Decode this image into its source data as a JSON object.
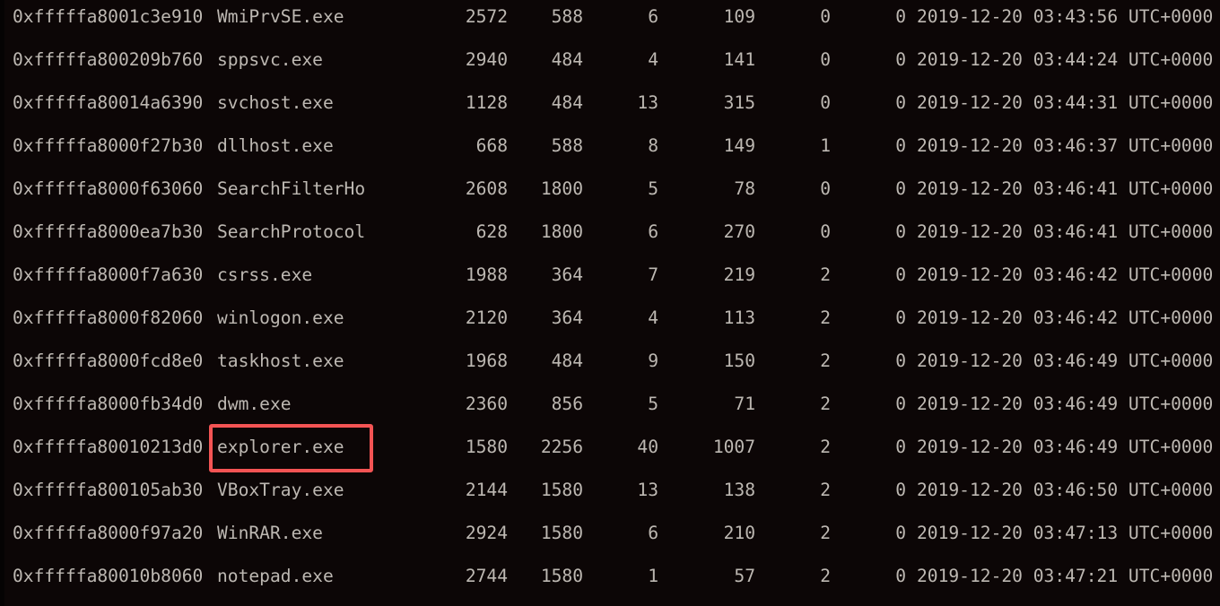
{
  "terminal": {
    "highlight_color": "#f45454",
    "highlighted_process": "explorer.exe",
    "rows": [
      {
        "offset": "0xfffffa8001c3e910",
        "name": "WmiPrvSE.exe",
        "pid": "2572",
        "ppid": "588",
        "threads": "6",
        "handles": "109",
        "session": "0",
        "wow64": "0",
        "start": "2019-12-20 03:43:56 UTC+0000"
      },
      {
        "offset": "0xfffffa800209b760",
        "name": "sppsvc.exe",
        "pid": "2940",
        "ppid": "484",
        "threads": "4",
        "handles": "141",
        "session": "0",
        "wow64": "0",
        "start": "2019-12-20 03:44:24 UTC+0000"
      },
      {
        "offset": "0xfffffa80014a6390",
        "name": "svchost.exe",
        "pid": "1128",
        "ppid": "484",
        "threads": "13",
        "handles": "315",
        "session": "0",
        "wow64": "0",
        "start": "2019-12-20 03:44:31 UTC+0000"
      },
      {
        "offset": "0xfffffa8000f27b30",
        "name": "dllhost.exe",
        "pid": "668",
        "ppid": "588",
        "threads": "8",
        "handles": "149",
        "session": "1",
        "wow64": "0",
        "start": "2019-12-20 03:46:37 UTC+0000"
      },
      {
        "offset": "0xfffffa8000f63060",
        "name": "SearchFilterHo",
        "pid": "2608",
        "ppid": "1800",
        "threads": "5",
        "handles": "78",
        "session": "0",
        "wow64": "0",
        "start": "2019-12-20 03:46:41 UTC+0000"
      },
      {
        "offset": "0xfffffa8000ea7b30",
        "name": "SearchProtocol",
        "pid": "628",
        "ppid": "1800",
        "threads": "6",
        "handles": "270",
        "session": "0",
        "wow64": "0",
        "start": "2019-12-20 03:46:41 UTC+0000"
      },
      {
        "offset": "0xfffffa8000f7a630",
        "name": "csrss.exe",
        "pid": "1988",
        "ppid": "364",
        "threads": "7",
        "handles": "219",
        "session": "2",
        "wow64": "0",
        "start": "2019-12-20 03:46:42 UTC+0000"
      },
      {
        "offset": "0xfffffa8000f82060",
        "name": "winlogon.exe",
        "pid": "2120",
        "ppid": "364",
        "threads": "4",
        "handles": "113",
        "session": "2",
        "wow64": "0",
        "start": "2019-12-20 03:46:42 UTC+0000"
      },
      {
        "offset": "0xfffffa8000fcd8e0",
        "name": "taskhost.exe",
        "pid": "1968",
        "ppid": "484",
        "threads": "9",
        "handles": "150",
        "session": "2",
        "wow64": "0",
        "start": "2019-12-20 03:46:49 UTC+0000"
      },
      {
        "offset": "0xfffffa8000fb34d0",
        "name": "dwm.exe",
        "pid": "2360",
        "ppid": "856",
        "threads": "5",
        "handles": "71",
        "session": "2",
        "wow64": "0",
        "start": "2019-12-20 03:46:49 UTC+0000"
      },
      {
        "offset": "0xfffffa80010213d0",
        "name": "explorer.exe",
        "pid": "1580",
        "ppid": "2256",
        "threads": "40",
        "handles": "1007",
        "session": "2",
        "wow64": "0",
        "start": "2019-12-20 03:46:49 UTC+0000"
      },
      {
        "offset": "0xfffffa800105ab30",
        "name": "VBoxTray.exe",
        "pid": "2144",
        "ppid": "1580",
        "threads": "13",
        "handles": "138",
        "session": "2",
        "wow64": "0",
        "start": "2019-12-20 03:46:50 UTC+0000"
      },
      {
        "offset": "0xfffffa8000f97a20",
        "name": "WinRAR.exe",
        "pid": "2924",
        "ppid": "1580",
        "threads": "6",
        "handles": "210",
        "session": "2",
        "wow64": "0",
        "start": "2019-12-20 03:47:13 UTC+0000"
      },
      {
        "offset": "0xfffffa80010b8060",
        "name": "notepad.exe",
        "pid": "2744",
        "ppid": "1580",
        "threads": "1",
        "handles": "57",
        "session": "2",
        "wow64": "0",
        "start": "2019-12-20 03:47:21 UTC+0000"
      }
    ]
  }
}
